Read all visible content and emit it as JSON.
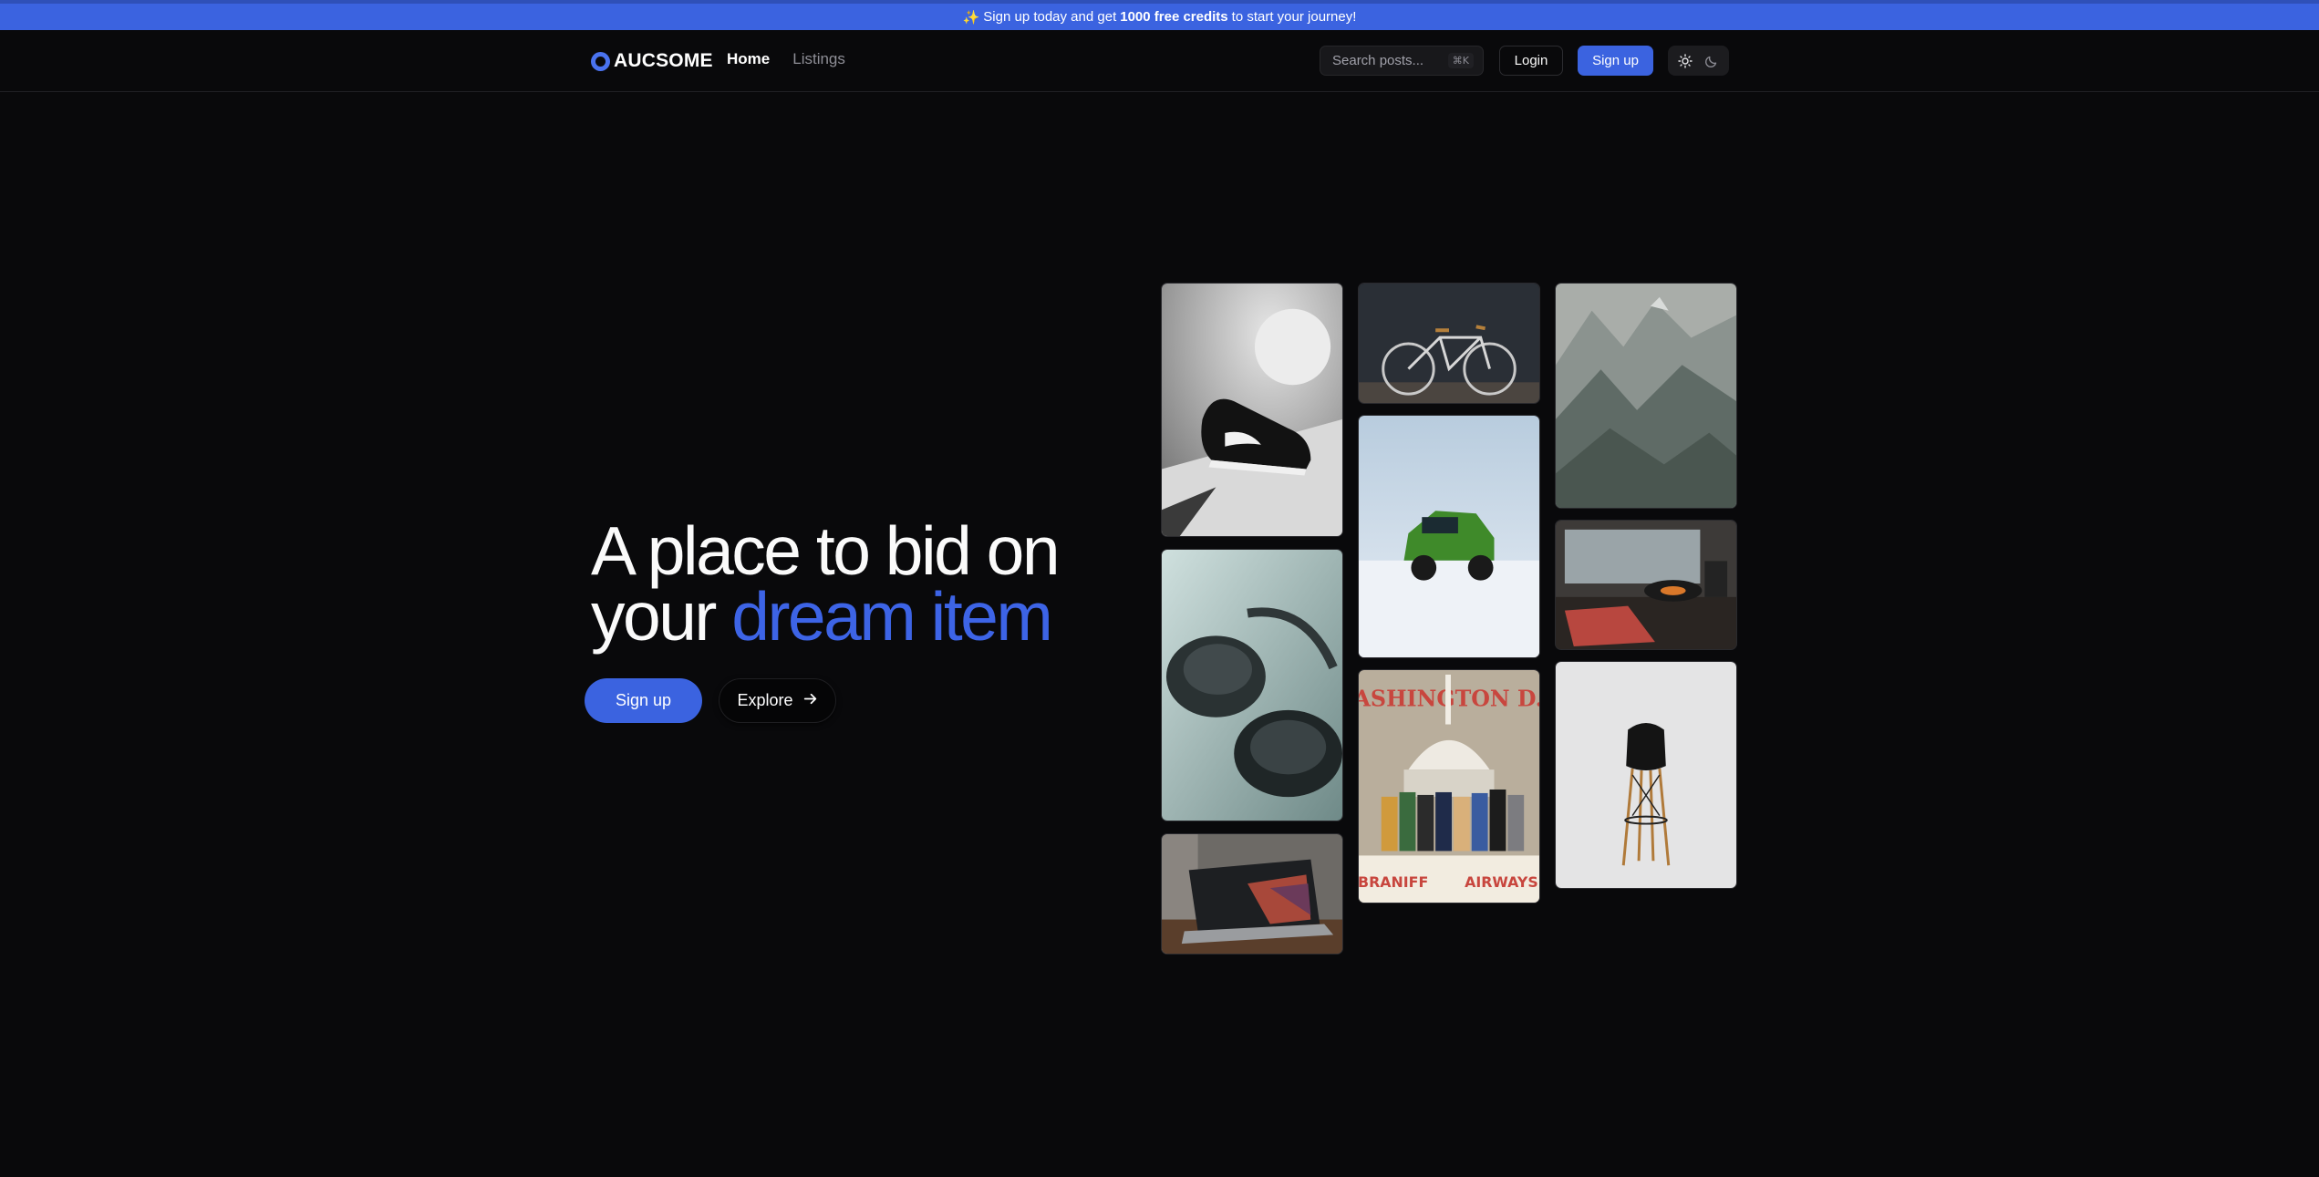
{
  "banner": {
    "emoji": "✨",
    "text_before": "Sign up today and get",
    "highlight": "1000 free credits",
    "text_after": "to start your journey!"
  },
  "header": {
    "logo_text": "AUCSOME",
    "nav": [
      {
        "label": "Home",
        "active": true
      },
      {
        "label": "Listings",
        "active": false
      }
    ],
    "search": {
      "placeholder": "Search posts...",
      "shortcut": "⌘K"
    },
    "login_label": "Login",
    "signup_label": "Sign up",
    "theme_toggle": {
      "light_icon": "sun-icon",
      "dark_icon": "moon-icon"
    }
  },
  "hero": {
    "title_line1": "A place to bid on",
    "title_line2_plain": "your",
    "title_line2_accent": "dream item",
    "signup_label": "Sign up",
    "explore_label": "Explore",
    "explore_icon": "arrow-right-icon"
  },
  "gallery": {
    "tiles": [
      {
        "name": "sneaker-image",
        "alt": "sneaker"
      },
      {
        "name": "headphones-image",
        "alt": "headphones"
      },
      {
        "name": "laptop-image",
        "alt": "laptop"
      },
      {
        "name": "bicycle-image",
        "alt": "bicycle"
      },
      {
        "name": "green-truck-image",
        "alt": "green truck"
      },
      {
        "name": "washington-poster-image",
        "alt": "poster",
        "poster_top": "WASHINGTON D.C.",
        "poster_bottom_left": "BRANIFF",
        "poster_bottom_right": "AIRWAYS"
      },
      {
        "name": "mountain-painting-image",
        "alt": "painting"
      },
      {
        "name": "record-player-image",
        "alt": "record player"
      },
      {
        "name": "chair-image",
        "alt": "chair"
      }
    ]
  },
  "colors": {
    "background": "#09090b",
    "accent": "#3b63e0",
    "banner": "#3b63e0"
  }
}
